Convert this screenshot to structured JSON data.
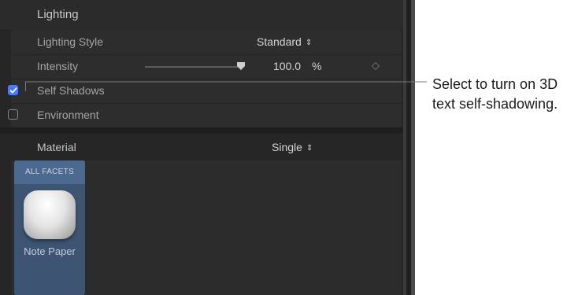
{
  "inspector": {
    "lighting_section": {
      "title": "Lighting"
    },
    "lighting_style": {
      "label": "Lighting Style",
      "value": "Standard"
    },
    "intensity": {
      "label": "Intensity",
      "value": "100.0",
      "unit": "%",
      "slider_fraction": 1.0
    },
    "self_shadows": {
      "label": "Self Shadows",
      "checked": true
    },
    "environment": {
      "label": "Environment",
      "checked": false
    },
    "material": {
      "label": "Material",
      "value": "Single",
      "facet_tab": "ALL FACETS",
      "swatch_label": "Note Paper"
    }
  },
  "callout": {
    "text": "Select to turn on 3D text self-shadowing."
  },
  "colors": {
    "panel_bg": "#262626",
    "checkbox_accent": "#4a79ff",
    "facet_card": "#3d5573"
  },
  "icons": {
    "updown": "chevron-updown-icon",
    "keyframe": "diamond-keyframe-icon",
    "checkmark": "checkmark-icon"
  }
}
